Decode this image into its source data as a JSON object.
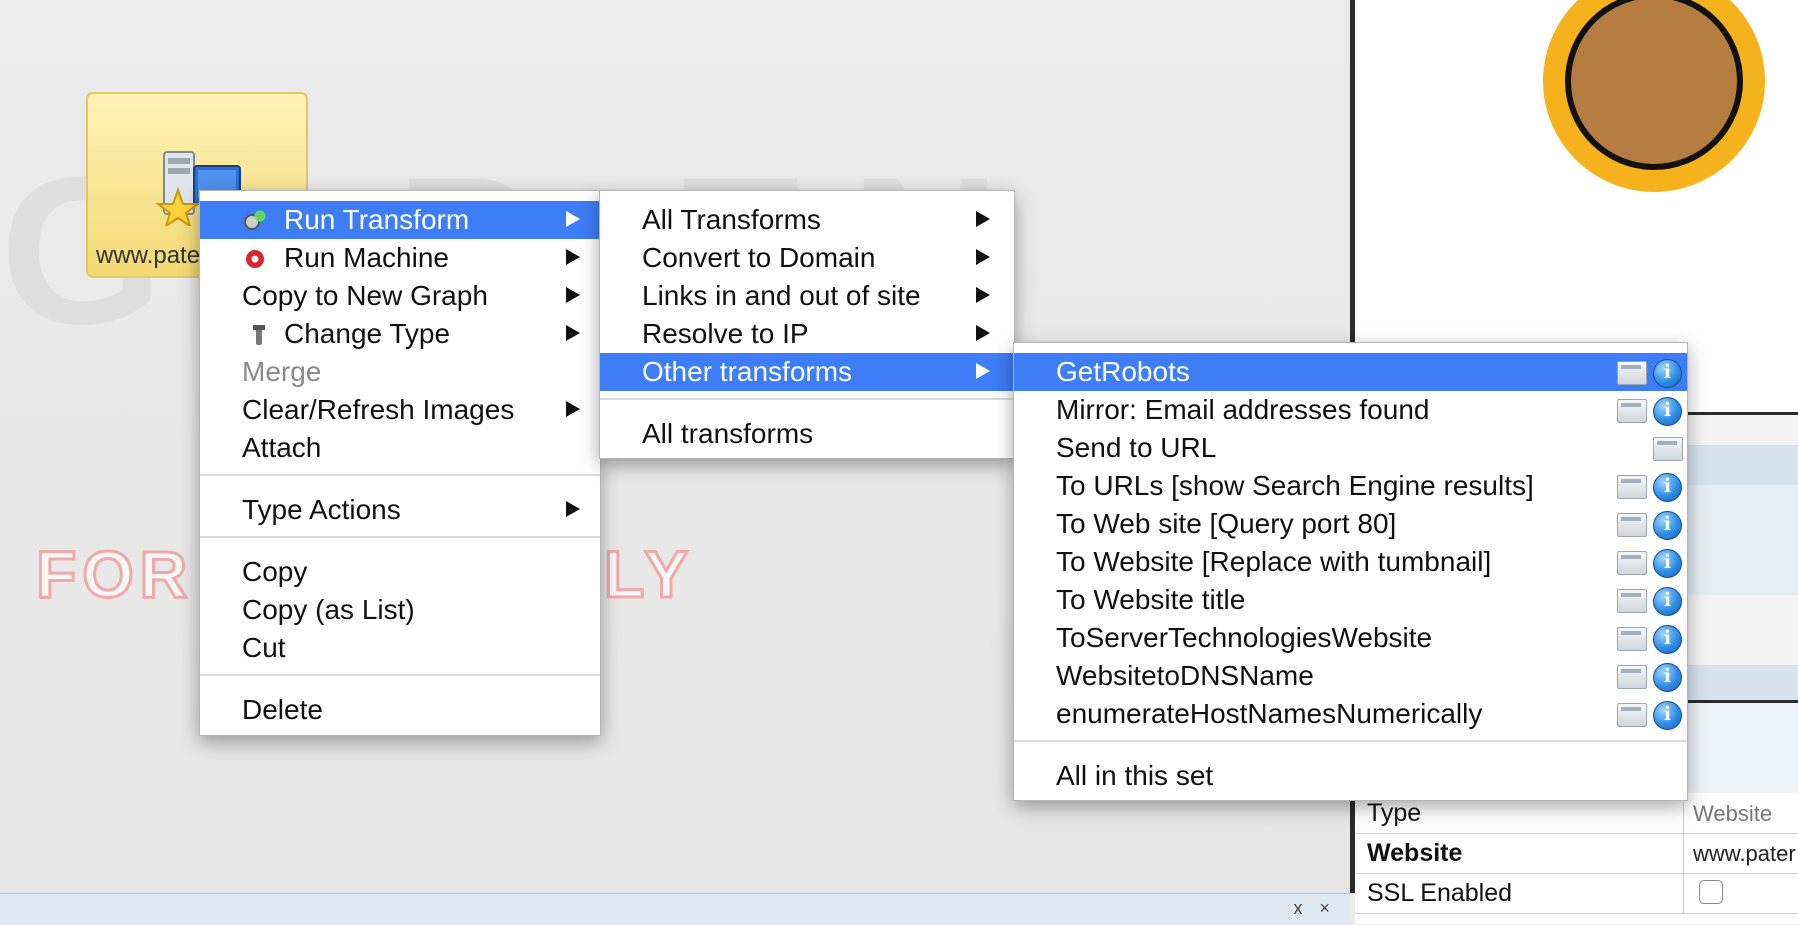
{
  "canvas": {
    "watermark_big": "GAP EN",
    "watermark_notice": "FOR ... USE ONLY",
    "entity_label": "www.pate"
  },
  "context_menu": {
    "items": [
      {
        "label": "Run Transform",
        "submenu": true,
        "highlighted": true,
        "icon": "gears-icon"
      },
      {
        "label": "Run Machine",
        "submenu": true,
        "icon": "machine-icon"
      },
      {
        "label": "Copy to New Graph",
        "submenu": true
      },
      {
        "label": "Change Type",
        "submenu": true,
        "icon": "tool-icon"
      },
      {
        "label": "Merge",
        "disabled": true
      },
      {
        "label": "Clear/Refresh Images",
        "submenu": true
      },
      {
        "label": "Attach"
      },
      {
        "label": "Type Actions",
        "submenu": true
      },
      {
        "label": "Copy"
      },
      {
        "label": "Copy (as List)"
      },
      {
        "label": "Cut"
      },
      {
        "label": "Delete"
      }
    ]
  },
  "transform_menu": {
    "items": [
      {
        "label": "All Transforms",
        "submenu": true
      },
      {
        "label": "Convert to Domain",
        "submenu": true
      },
      {
        "label": "Links in and out of site",
        "submenu": true
      },
      {
        "label": "Resolve to IP",
        "submenu": true
      },
      {
        "label": "Other transforms",
        "submenu": true,
        "highlighted": true
      },
      {
        "label": "All transforms"
      }
    ]
  },
  "other_menu": {
    "items": [
      {
        "label": "GetRobots",
        "highlighted": true,
        "info": true
      },
      {
        "label": "Mirror: Email addresses found",
        "info": true
      },
      {
        "label": "Send to URL",
        "info": false
      },
      {
        "label": "To URLs [show Search Engine results]",
        "info": true
      },
      {
        "label": "To Web site [Query port 80]",
        "info": true
      },
      {
        "label": "To Website [Replace with tumbnail]",
        "info": true
      },
      {
        "label": "To Website title",
        "info": true
      },
      {
        "label": "ToServerTechnologiesWebsite",
        "info": true
      },
      {
        "label": "WebsitetoDNSName",
        "info": true
      },
      {
        "label": "enumerateHostNamesNumerically",
        "info": true
      },
      {
        "label": "All in this set"
      }
    ]
  },
  "properties": {
    "rows": [
      {
        "key": "Type",
        "value": "Website"
      },
      {
        "key": "Website",
        "value": "www.pater"
      },
      {
        "key": "SSL Enabled",
        "value": ""
      }
    ]
  },
  "bottom_panel": {
    "controls": "x ×"
  },
  "colors": {
    "highlight": "#3d7df6",
    "node_ring": "#f6b21c",
    "node_fill": "#b57d3f"
  }
}
